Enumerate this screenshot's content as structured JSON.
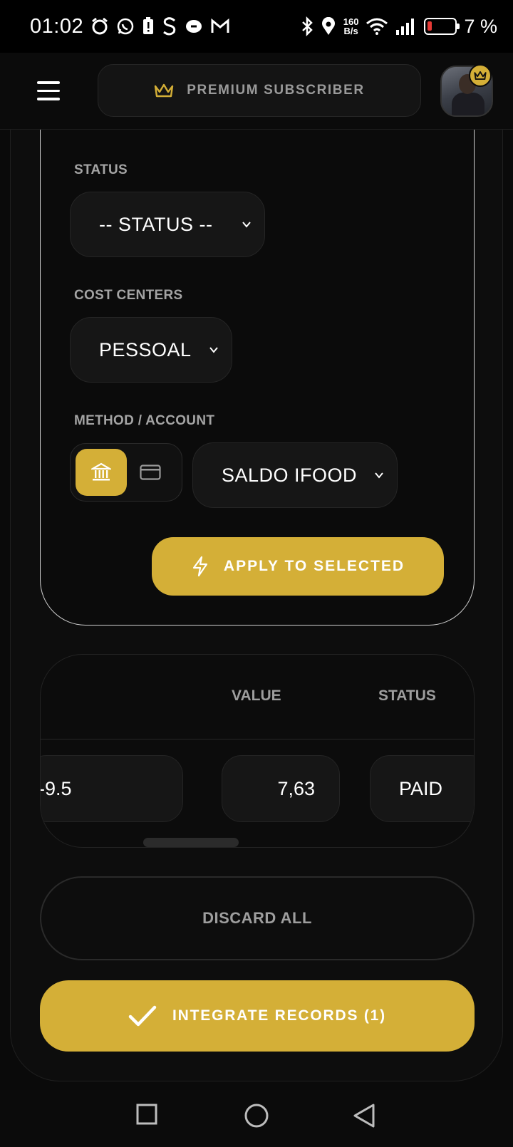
{
  "status_bar": {
    "time": "01:02",
    "network_speed_value": "160",
    "network_speed_unit": "B/s",
    "battery_percent": "7 %",
    "battery_level": 0.07
  },
  "header": {
    "premium_label": "PREMIUM SUBSCRIBER",
    "accent_color": "#d4af37"
  },
  "filters": {
    "status": {
      "label": "STATUS",
      "value": "-- STATUS --"
    },
    "cost_centers": {
      "label": "COST CENTERS",
      "value": "PESSOAL"
    },
    "method": {
      "label": "METHOD / ACCOUNT",
      "options": [
        "bank-icon",
        "credit-card-icon"
      ],
      "selected": "bank-icon",
      "account_value": "SALDO IFOOD"
    },
    "apply_label": "APPLY TO SELECTED"
  },
  "table": {
    "columns": [
      "VALUE",
      "STATUS"
    ],
    "rows": [
      {
        "partial_cell": "-9.5",
        "value": "7,63",
        "status": "PAID"
      }
    ]
  },
  "actions": {
    "discard_label": "DISCARD ALL",
    "integrate_label": "INTEGRATE RECORDS (1)"
  },
  "nav": [
    "recents-square-icon",
    "home-circle-icon",
    "back-triangle-icon"
  ]
}
